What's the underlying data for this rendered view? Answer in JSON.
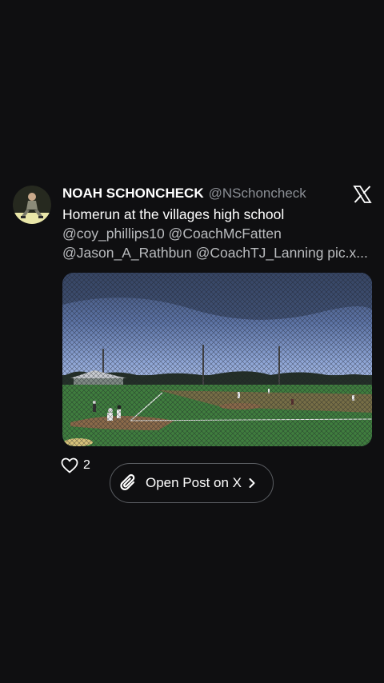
{
  "post": {
    "author": {
      "display_name": "NOAH SCHONCHECK",
      "handle": "@NSchoncheck"
    },
    "text_line1": "Homerun at the villages high school",
    "text_line2": "@coy_phillips10 @CoachMcFatten",
    "text_line3": "@Jason_A_Rathbun @CoachTJ_Lanning pic.x...",
    "media": {
      "description_icon": "baseball-field-photo"
    },
    "likes": {
      "icon": "heart-icon",
      "count": "2"
    },
    "open_button": {
      "label": "Open Post on X",
      "icon": "paperclip-icon",
      "trailing_icon": "chevron-right-icon"
    }
  },
  "colors": {
    "background": "#0f0f11",
    "text": "#ffffff",
    "muted": "#8b8f95",
    "button_border": "#5a5d62"
  }
}
